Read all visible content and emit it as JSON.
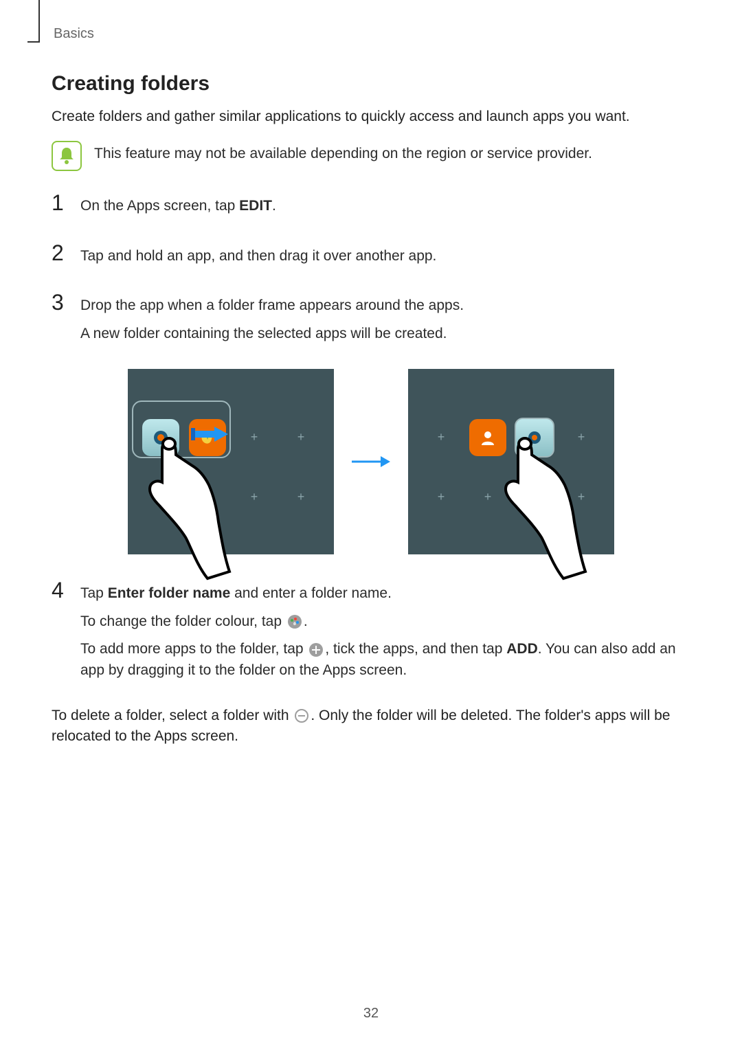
{
  "runningHead": "Basics",
  "title": "Creating folders",
  "intro": "Create folders and gather similar applications to quickly access and launch apps you want.",
  "note": "This feature may not be available depending on the region or service provider.",
  "steps": {
    "s1": {
      "num": "1",
      "a": "On the Apps screen, tap ",
      "b": "EDIT",
      "c": "."
    },
    "s2": {
      "num": "2",
      "text": "Tap and hold an app, and then drag it over another app."
    },
    "s3": {
      "num": "3",
      "line1": "Drop the app when a folder frame appears around the apps.",
      "line2": "A new folder containing the selected apps will be created."
    },
    "s4": {
      "num": "4",
      "p1a": "Tap ",
      "p1b": "Enter folder name",
      "p1c": " and enter a folder name.",
      "p2a": "To change the folder colour, tap ",
      "p3a": "To add more apps to the folder, tap ",
      "p3b": ", tick the apps, and then tap ",
      "p3c": "ADD",
      "p3d": ". You can also add an app by dragging it to the folder on the Apps screen."
    }
  },
  "closing": {
    "a": "To delete a folder, select a folder with ",
    "b": ". Only the folder will be deleted. The folder's apps will be relocated to the Apps screen."
  },
  "pageNumber": "32"
}
